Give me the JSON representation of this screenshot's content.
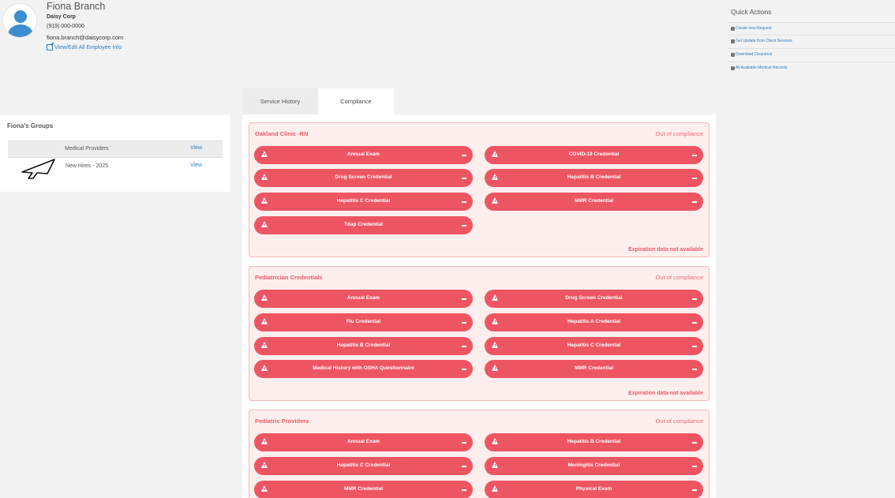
{
  "profile": {
    "name": "Fiona Branch",
    "company": "Daisy Corp",
    "phone": "(919) 000-0000",
    "email": "fiona.branch@daisycorp.com",
    "edit_link": "View/Edit All Employee Info"
  },
  "groups": {
    "title": "Fiona's Groups",
    "items": [
      {
        "label": "Medical Providers",
        "action": "View"
      },
      {
        "label": "New Hires - 2025",
        "action": "View"
      }
    ]
  },
  "tabs": [
    {
      "label": "Service History",
      "active": false
    },
    {
      "label": "Compliance",
      "active": true
    }
  ],
  "quick_actions": {
    "title": "Quick Actions",
    "items": [
      {
        "label": "Create new Request",
        "icon": "edit-icon"
      },
      {
        "label": "Get Update from Client Services",
        "icon": "flag-icon"
      },
      {
        "label": "Download Clearance",
        "icon": "download-icon"
      },
      {
        "label": "All Available Medical Records",
        "icon": "file-icon"
      }
    ]
  },
  "compliance_cards": [
    {
      "title": "Oakland Clinic -RN",
      "status": "Out of compliance",
      "footer": "Expiration data not available",
      "credentials": [
        "Annual Exam",
        "COVID-19 Credential",
        "Drug Screen Credential",
        "Hepatitis B Credential",
        "Hepatitis C Credential",
        "MMR Credential",
        "Tdap Credential"
      ]
    },
    {
      "title": "Pediatrician Credentials",
      "status": "Out of compliance",
      "footer": "Expiration data not available",
      "credentials": [
        "Annual Exam",
        "Drug Screen Credential",
        "Flu Credential",
        "Hepatitis A Credential",
        "Hepatitis B Credential",
        "Hepatitis C Credential",
        "Medical History with OSHA Questionnaire",
        "MMR Credential"
      ]
    },
    {
      "title": "Pediatric Providers",
      "status": "Out of compliance",
      "footer": "",
      "credentials": [
        "Annual Exam",
        "Hepatitis B Credential",
        "Hepatitis C Credential",
        "Meningitis Credential",
        "MMR Credential",
        "Physical Exam"
      ]
    }
  ],
  "colors": {
    "accent_link": "#2e7bbf",
    "alert_red": "#ee5562",
    "alert_bg": "#fdeeee"
  }
}
